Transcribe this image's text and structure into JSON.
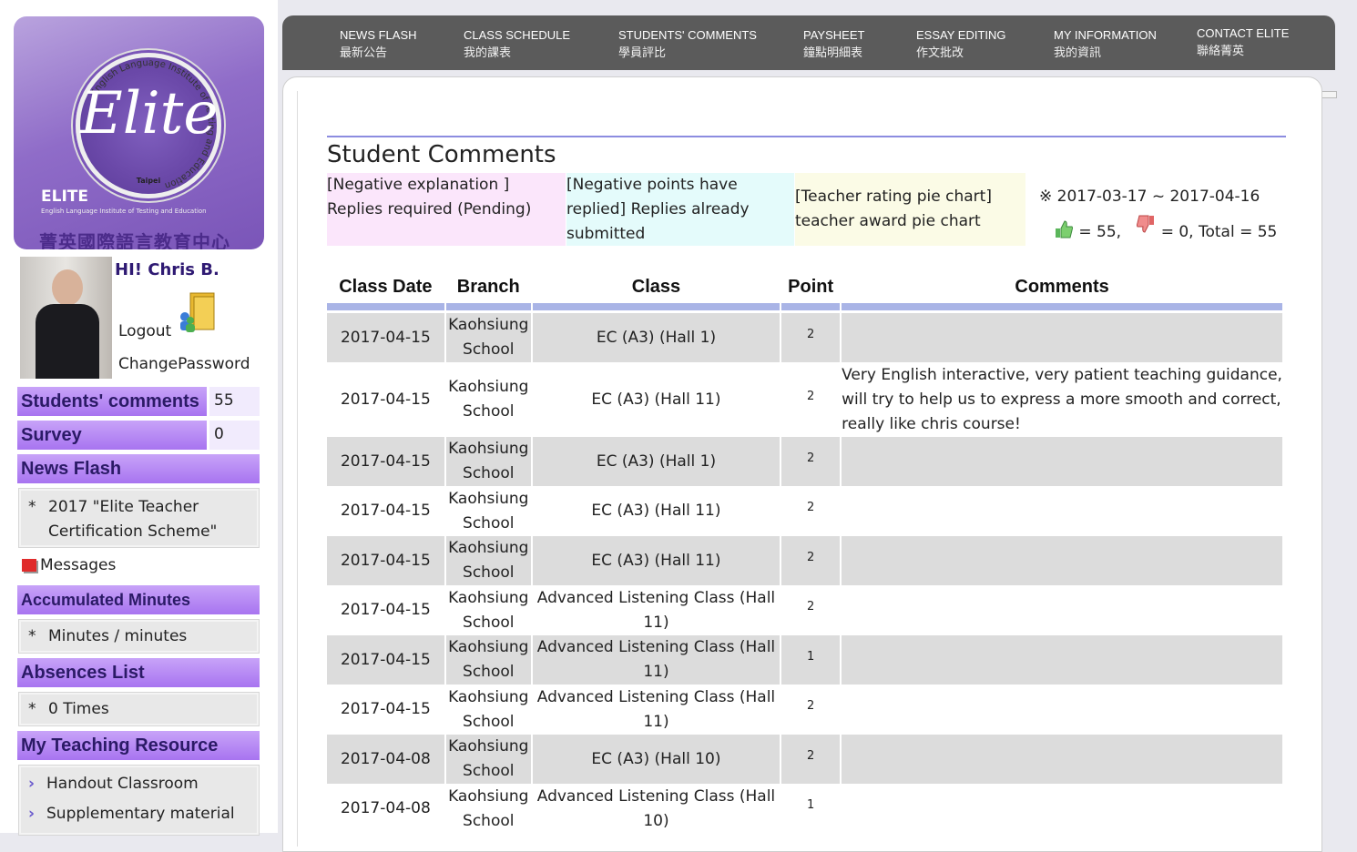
{
  "logo": {
    "script": "Elite",
    "ring_text": "English Language Institute of Testing and Education",
    "city": "Taipei",
    "brand": "ELITE",
    "subtitle": "English Language Institute of Testing and Education",
    "chinese": "菁英國際語言教育中心"
  },
  "user": {
    "greeting": "HI! Chris B.",
    "logout": "Logout",
    "change_password": "ChangePassword"
  },
  "sidebar": {
    "students_comments": {
      "label": "Students' comments",
      "count": "55"
    },
    "survey": {
      "label": "Survey",
      "count": "0"
    },
    "news_flash": {
      "label": "News Flash",
      "star": "*",
      "item": "2017 \"Elite Teacher Certification Scheme\""
    },
    "messages": "Messages",
    "accumulated_minutes": {
      "label": "Accumulated Minutes",
      "star": "*",
      "item": "Minutes / minutes"
    },
    "absences": {
      "label": "Absences List",
      "star": "*",
      "item": "0 Times"
    },
    "teaching_resource": {
      "label": "My Teaching Resource",
      "items": [
        "Handout Classroom",
        "Supplementary material"
      ]
    }
  },
  "nav": [
    {
      "en": "NEWS FLASH",
      "cn": "最新公告"
    },
    {
      "en": "CLASS SCHEDULE",
      "cn": "我的課表"
    },
    {
      "en": "STUDENTS' COMMENTS",
      "cn": "學員評比"
    },
    {
      "en": "PAYSHEET",
      "cn": "鐘點明細表"
    },
    {
      "en": "ESSAY EDITING",
      "cn": "作文批改"
    },
    {
      "en": "MY INFORMATION",
      "cn": "我的資訊"
    },
    {
      "en": "CONTACT ELITE",
      "cn": "聯絡菁英"
    }
  ],
  "page": {
    "title": "Student Comments",
    "legend": [
      {
        "text": "[Negative explanation ] Replies required (Pending)",
        "color": "#fbe6fb"
      },
      {
        "text": "[Negative points have replied] Replies already submitted",
        "color": "#e4fbfb"
      },
      {
        "text": "[Teacher rating pie chart] teacher award pie chart",
        "color": "#fbfbe6"
      }
    ],
    "date_range": "※ 2017-03-17 ~ 2017-04-16",
    "totals": {
      "positive": "= 55,",
      "negative": "= 0, Total = 55"
    }
  },
  "table": {
    "headers": [
      "Class Date",
      "Branch",
      "Class",
      "Point",
      "Comments"
    ],
    "rows": [
      {
        "date": "2017-04-15",
        "branch": "Kaohsiung School",
        "class": "EC (A3) (Hall 1)",
        "point": "2",
        "comment": ""
      },
      {
        "date": "2017-04-15",
        "branch": "Kaohsiung School",
        "class": "EC (A3) (Hall 11)",
        "point": "2",
        "comment": "Very English interactive, very patient teaching guidance, will try to help us to express a more smooth and correct, really like chris course!"
      },
      {
        "date": "2017-04-15",
        "branch": "Kaohsiung School",
        "class": "EC (A3) (Hall 1)",
        "point": "2",
        "comment": ""
      },
      {
        "date": "2017-04-15",
        "branch": "Kaohsiung School",
        "class": "EC (A3) (Hall 11)",
        "point": "2",
        "comment": ""
      },
      {
        "date": "2017-04-15",
        "branch": "Kaohsiung School",
        "class": "EC (A3) (Hall 11)",
        "point": "2",
        "comment": ""
      },
      {
        "date": "2017-04-15",
        "branch": "Kaohsiung School",
        "class": "Advanced Listening Class (Hall 11)",
        "point": "2",
        "comment": ""
      },
      {
        "date": "2017-04-15",
        "branch": "Kaohsiung School",
        "class": "Advanced Listening Class (Hall 11)",
        "point": "1",
        "comment": ""
      },
      {
        "date": "2017-04-15",
        "branch": "Kaohsiung School",
        "class": "Advanced Listening Class (Hall 11)",
        "point": "2",
        "comment": ""
      },
      {
        "date": "2017-04-08",
        "branch": "Kaohsiung School",
        "class": "EC (A3) (Hall 10)",
        "point": "2",
        "comment": ""
      },
      {
        "date": "2017-04-08",
        "branch": "Kaohsiung School",
        "class": "Advanced Listening Class (Hall 10)",
        "point": "1",
        "comment": ""
      }
    ]
  },
  "colors": {
    "accent": "#a874f0",
    "nav_bg": "#5b5b5b",
    "row_gray": "#dcdcdc",
    "header_rule": "#a9b4e6"
  }
}
